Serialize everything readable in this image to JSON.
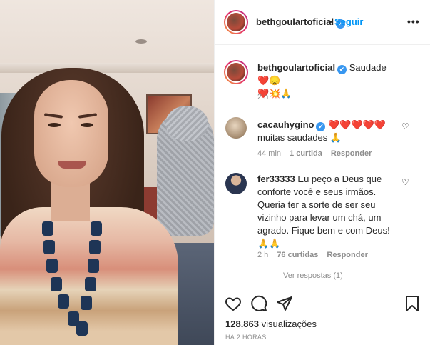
{
  "header": {
    "username": "bethgoulartoficial",
    "verified_mark": "✔",
    "dot": "•",
    "follow_label": "Seguir",
    "more_label": "•••"
  },
  "caption": {
    "username": "bethgoulartoficial",
    "text_line1": "Saudade ❤️😞",
    "text_line2": "❤️💥🙏",
    "time": "2 h"
  },
  "comments": [
    {
      "username": "cacauhygino",
      "hearts": "❤️❤️❤️❤️❤️",
      "text": "muitas saudades 🙏",
      "time": "44 min",
      "likes": "1 curtida",
      "reply": "Responder"
    },
    {
      "username": "fer33333",
      "text": "Eu peço a Deus que conforte você e seus irmãos. Queria ter a sorte de ser seu vizinho para levar um chá, um agrado. Fique bem e com Deus! 🙏🙏",
      "time": "2 h",
      "likes": "76 curtidas",
      "reply": "Responder"
    }
  ],
  "view_replies": "Ver respostas (1)",
  "footer": {
    "views_count": "128.863",
    "views_label": "visualizações",
    "timestamp": "HÁ 2 HORAS"
  },
  "icons": {
    "like": "heart-icon",
    "comment": "comment-icon",
    "share": "share-icon",
    "save": "bookmark-icon"
  },
  "colors": {
    "link": "#0095f6",
    "verified": "#3897f0",
    "muted": "#8e8e8e",
    "text": "#262626"
  }
}
